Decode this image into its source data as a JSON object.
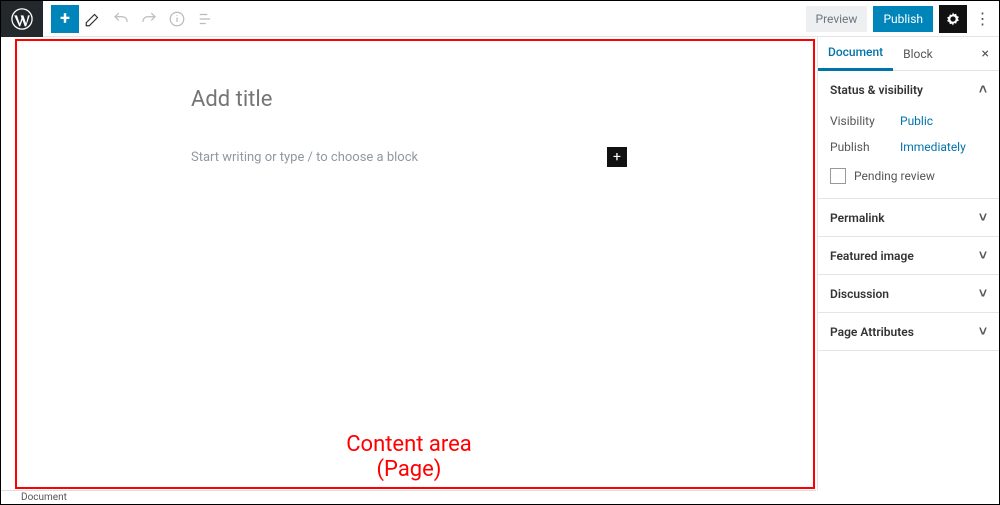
{
  "topbar": {
    "preview_label": "Preview",
    "publish_label": "Publish"
  },
  "editor": {
    "title_placeholder": "Add title",
    "block_placeholder": "Start writing or type / to choose a block"
  },
  "annotation": {
    "line1": "Content area",
    "line2": "(Page)"
  },
  "sidebar": {
    "tabs": {
      "document": "Document",
      "block": "Block"
    },
    "close_glyph": "×",
    "panels": {
      "status": {
        "title": "Status & visibility",
        "visibility_label": "Visibility",
        "visibility_value": "Public",
        "publish_label": "Publish",
        "publish_value": "Immediately",
        "pending_label": "Pending review"
      },
      "permalink": {
        "title": "Permalink"
      },
      "featured": {
        "title": "Featured image"
      },
      "discussion": {
        "title": "Discussion"
      },
      "attributes": {
        "title": "Page Attributes"
      }
    }
  },
  "footer": {
    "breadcrumb": "Document"
  }
}
